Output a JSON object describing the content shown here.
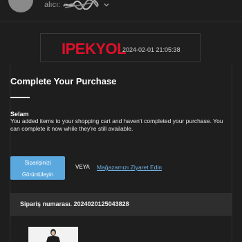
{
  "email_header": {
    "recipient_label": "alıcı:",
    "recipient_name": "Onl*** ***"
  },
  "brand_header": {
    "logo_text": "IPEKYOL",
    "datetime": "2024-02-01 21:05:38"
  },
  "body": {
    "title": "Complete Your Purchase",
    "greeting": "Selam",
    "message": "You added items to your shopping cart and haven't completed your purchase. You can complete it now while they're still available."
  },
  "actions": {
    "view_order_line1": "Siparişinizi",
    "view_order_line2": "Görüntüleyin",
    "or_text": "VEYA",
    "visit_store": "Mağazamızı Ziyaret Edin"
  },
  "order": {
    "number_text": "Sipariş numarası. 2024020125043828"
  },
  "colors": {
    "brand_red": "#e0102a",
    "button_blue": "#5aa8de",
    "link_blue": "#6fb3e8",
    "background": "#1e1e1e"
  },
  "icons": {
    "avatar": "avatar",
    "dropdown": "chevron-down-icon",
    "redaction": "scribble-redaction"
  }
}
